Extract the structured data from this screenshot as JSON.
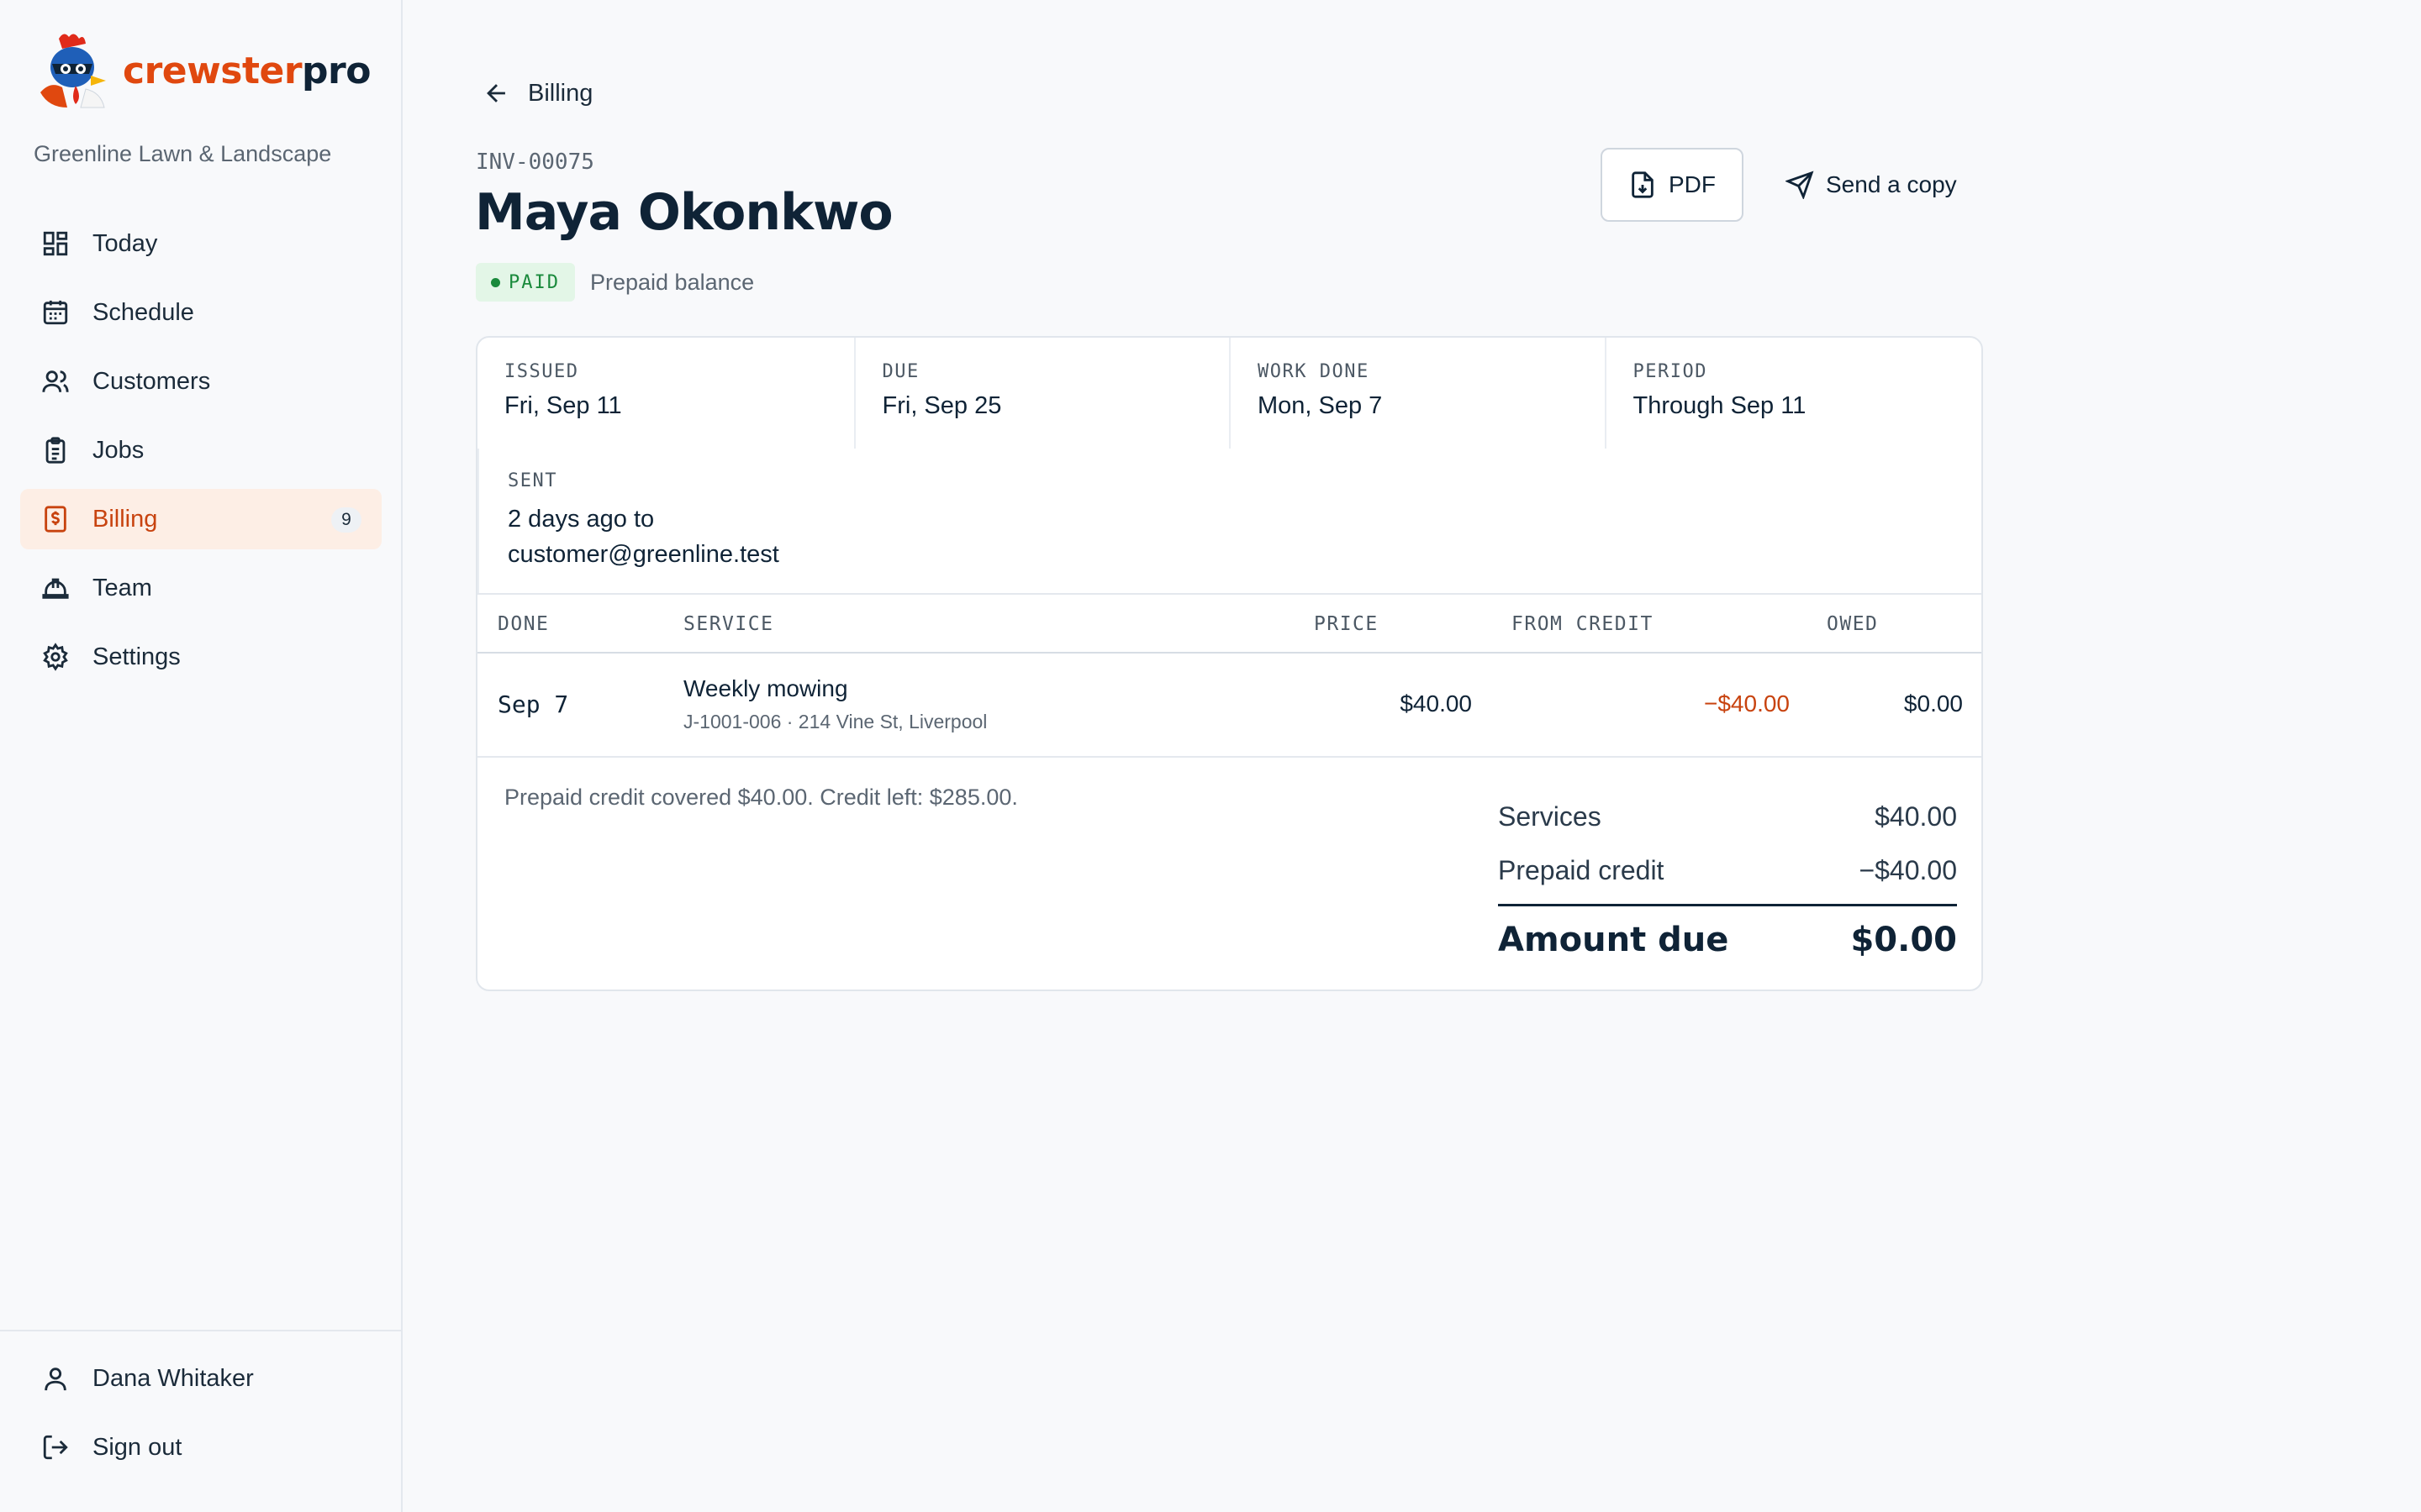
{
  "brand": {
    "name_part1": "crewster",
    "name_part2": "pro",
    "accent": "#e0480f"
  },
  "company": "Greenline Lawn & Landscape",
  "nav": [
    {
      "label": "Today",
      "icon": "dashboard-icon"
    },
    {
      "label": "Schedule",
      "icon": "calendar-icon"
    },
    {
      "label": "Customers",
      "icon": "users-icon"
    },
    {
      "label": "Jobs",
      "icon": "clipboard-icon"
    },
    {
      "label": "Billing",
      "icon": "invoice-icon",
      "badge": "9",
      "active": true
    },
    {
      "label": "Team",
      "icon": "hard-hat-icon"
    },
    {
      "label": "Settings",
      "icon": "gear-icon"
    }
  ],
  "user": {
    "name": "Dana Whitaker",
    "signout": "Sign out"
  },
  "back_label": "Billing",
  "invoice": {
    "number": "INV-00075",
    "customer": "Maya Okonkwo",
    "status": "PAID",
    "status_note": "Prepaid balance",
    "actions": {
      "pdf": "PDF",
      "send": "Send a copy"
    },
    "meta": [
      {
        "label": "ISSUED",
        "value": "Fri, Sep 11"
      },
      {
        "label": "DUE",
        "value": "Fri, Sep 25"
      },
      {
        "label": "WORK DONE",
        "value": "Mon, Sep 7"
      },
      {
        "label": "PERIOD",
        "value": "Through Sep 11"
      }
    ],
    "sent": {
      "label": "SENT",
      "line1": "2 days ago to",
      "line2": "customer@greenline.test"
    },
    "columns": {
      "done": "DONE",
      "service": "SERVICE",
      "price": "PRICE",
      "from_credit": "FROM CREDIT",
      "owed": "OWED"
    },
    "lines": [
      {
        "done": "Sep 7",
        "service": "Weekly mowing",
        "detail": "J-1001-006 · 214 Vine St, Liverpool",
        "price": "$40.00",
        "from_credit": "−$40.00",
        "owed": "$0.00"
      }
    ],
    "note": "Prepaid credit covered $40.00. Credit left: $285.00.",
    "totals": {
      "services_label": "Services",
      "services_value": "$40.00",
      "credit_label": "Prepaid credit",
      "credit_value": "−$40.00",
      "due_label": "Amount due",
      "due_value": "$0.00"
    }
  }
}
